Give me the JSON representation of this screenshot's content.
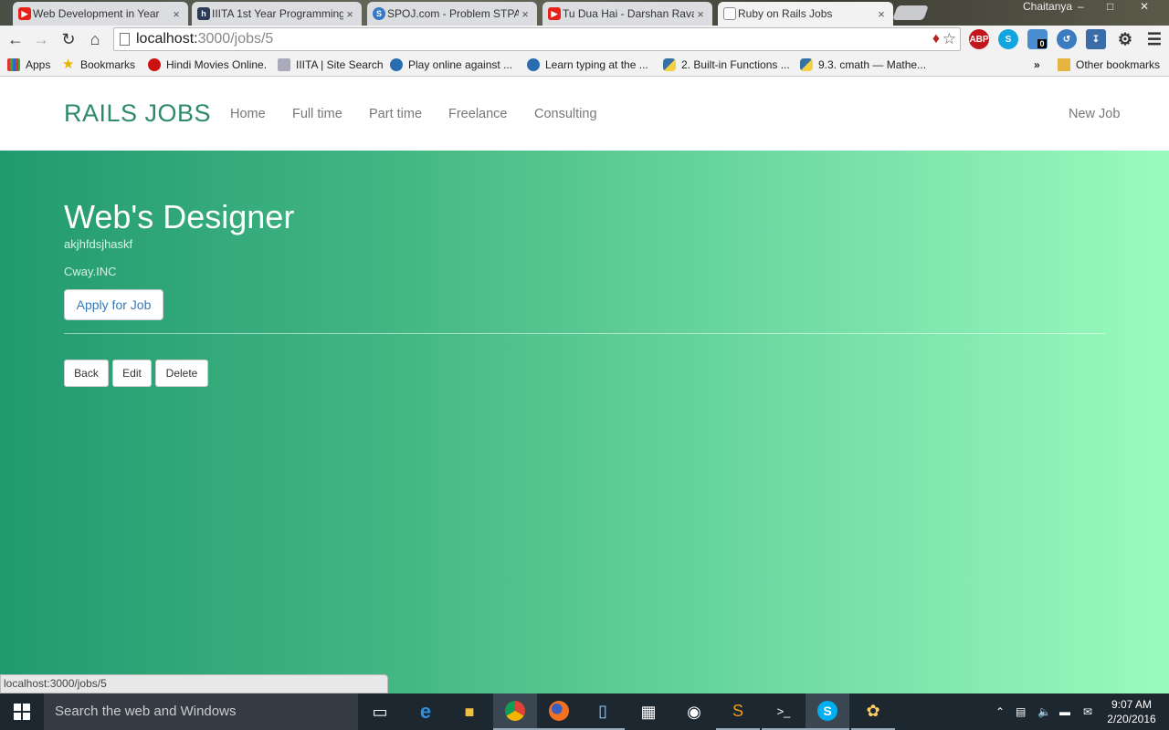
{
  "browser": {
    "tabs": [
      {
        "title": "Web Development in Year",
        "icon": "youtube-icon",
        "color": "#e62117"
      },
      {
        "title": "IIITA 1st Year Programming",
        "icon": "h-icon",
        "color": "#2b3a55"
      },
      {
        "title": "SPOJ.com - Problem STPAR",
        "icon": "spoj-icon",
        "color": "#3478c6"
      },
      {
        "title": "Tu Dua Hai - Darshan Raval",
        "icon": "youtube-icon",
        "color": "#e62117"
      },
      {
        "title": "Ruby on Rails Jobs",
        "icon": "page-icon",
        "color": "#ffffff"
      }
    ],
    "window_user": "Chaitanya",
    "url_host": "localhost:",
    "url_path": "3000/jobs/5",
    "extensions": [
      "ABP",
      "S"
    ],
    "badge_count": "0",
    "bookmarks": [
      {
        "label": "Apps",
        "icon": "apps-icon"
      },
      {
        "label": "Bookmarks",
        "icon": "star-icon"
      },
      {
        "label": "Hindi Movies Online.",
        "icon": "film-icon"
      },
      {
        "label": "IIITA | Site Search",
        "icon": "site-icon"
      },
      {
        "label": "Play online against ...",
        "icon": "chess-icon"
      },
      {
        "label": "Learn typing at the ...",
        "icon": "keyboard-icon"
      },
      {
        "label": "2. Built-in Functions ...",
        "icon": "python-icon"
      },
      {
        "label": "9.3. cmath — Mathe...",
        "icon": "python-icon"
      }
    ],
    "overflow_label": "»",
    "other_bookmarks": "Other bookmarks",
    "status_url": "localhost:3000/jobs/5"
  },
  "navbar": {
    "brand": "RAILS JOBS",
    "links": [
      "Home",
      "Full time",
      "Part time",
      "Freelance",
      "Consulting"
    ],
    "new_job": "New Job"
  },
  "job": {
    "title": "Web's Designer",
    "description": "akjhfdsjhaskf",
    "company": "Cway.INC",
    "apply_label": "Apply for Job",
    "actions": [
      "Back",
      "Edit",
      "Delete"
    ]
  },
  "taskbar": {
    "search_placeholder": "Search the web and Windows",
    "time": "9:07 AM",
    "date": "2/20/2016"
  },
  "colors": {
    "brand": "#2e8b67",
    "hero_start": "#229a70",
    "hero_end": "#9afbbd",
    "link": "#337ab7"
  }
}
